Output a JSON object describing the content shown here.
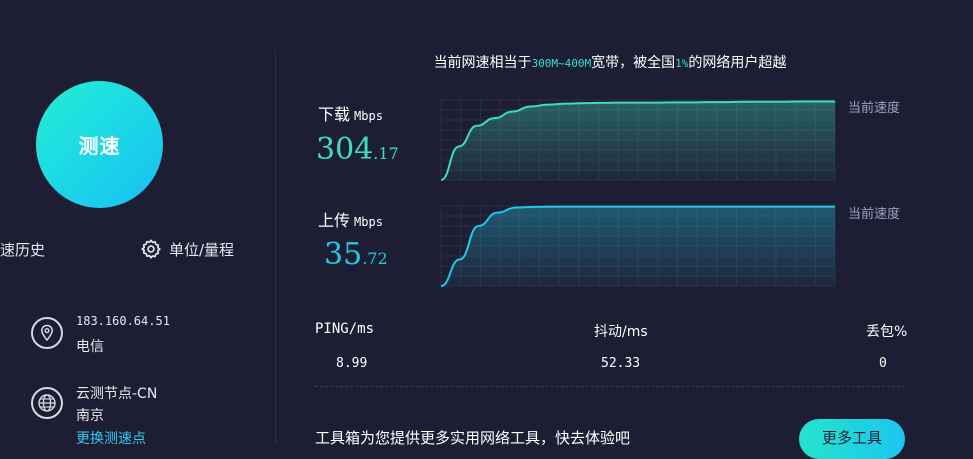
{
  "colors": {
    "background": "#1d1e33",
    "accent_teal": "#2fe0d2",
    "download_color": "#3ddfb9",
    "upload_color": "#22c8e6",
    "muted": "#9aa0bf"
  },
  "left_panel": {
    "speed_button_label": "测速",
    "history_label": "测速历史",
    "settings_label": "单位/量程",
    "settings_icon": "gear-icon",
    "ip": {
      "icon": "location-pin-icon",
      "address": "183.160.64.51",
      "isp": "电信"
    },
    "node": {
      "icon": "globe-icon",
      "name": "云测节点-CN",
      "city": "南京",
      "change_link": "更换测速点"
    }
  },
  "summary": {
    "prefix": "当前网速相当于",
    "range": "300M~400M",
    "mid": "宽带，被全国",
    "percent": "1%",
    "suffix": "的网络用户超越"
  },
  "download": {
    "label": "下载",
    "unit": "Mbps",
    "value_int": "304",
    "value_dec": ".17",
    "current_label": "当前速度"
  },
  "upload": {
    "label": "上传",
    "unit": "Mbps",
    "value_int": "35",
    "value_dec": ".72",
    "current_label": "当前速度"
  },
  "stats": [
    {
      "header": "PING/ms",
      "value": "8.99"
    },
    {
      "header": "抖动/ms",
      "value": "52.33"
    },
    {
      "header": "丢包%",
      "value": "0"
    }
  ],
  "tools": {
    "text": "工具箱为您提供更多实用网络工具，快去体验吧",
    "button_label": "更多工具"
  },
  "chart_data": [
    {
      "type": "area",
      "series": [
        {
          "values": [
            0,
            130,
            210,
            240,
            265,
            285,
            292,
            296,
            298,
            299,
            300,
            300,
            300,
            301,
            301,
            302,
            302,
            303,
            303,
            303,
            304,
            304,
            304
          ]
        }
      ],
      "ylim": [
        0,
        310
      ],
      "grid": true
    },
    {
      "type": "area",
      "series": [
        {
          "values": [
            0,
            12,
            27,
            33,
            35.3,
            35.6,
            35.7,
            35.7,
            35.7,
            35.7,
            35.7,
            35.7,
            35.7,
            35.7,
            35.7,
            35.7,
            35.7,
            35.7,
            35.7,
            35.7,
            35.72,
            35.72
          ]
        }
      ],
      "ylim": [
        0,
        36
      ],
      "grid": true
    }
  ]
}
